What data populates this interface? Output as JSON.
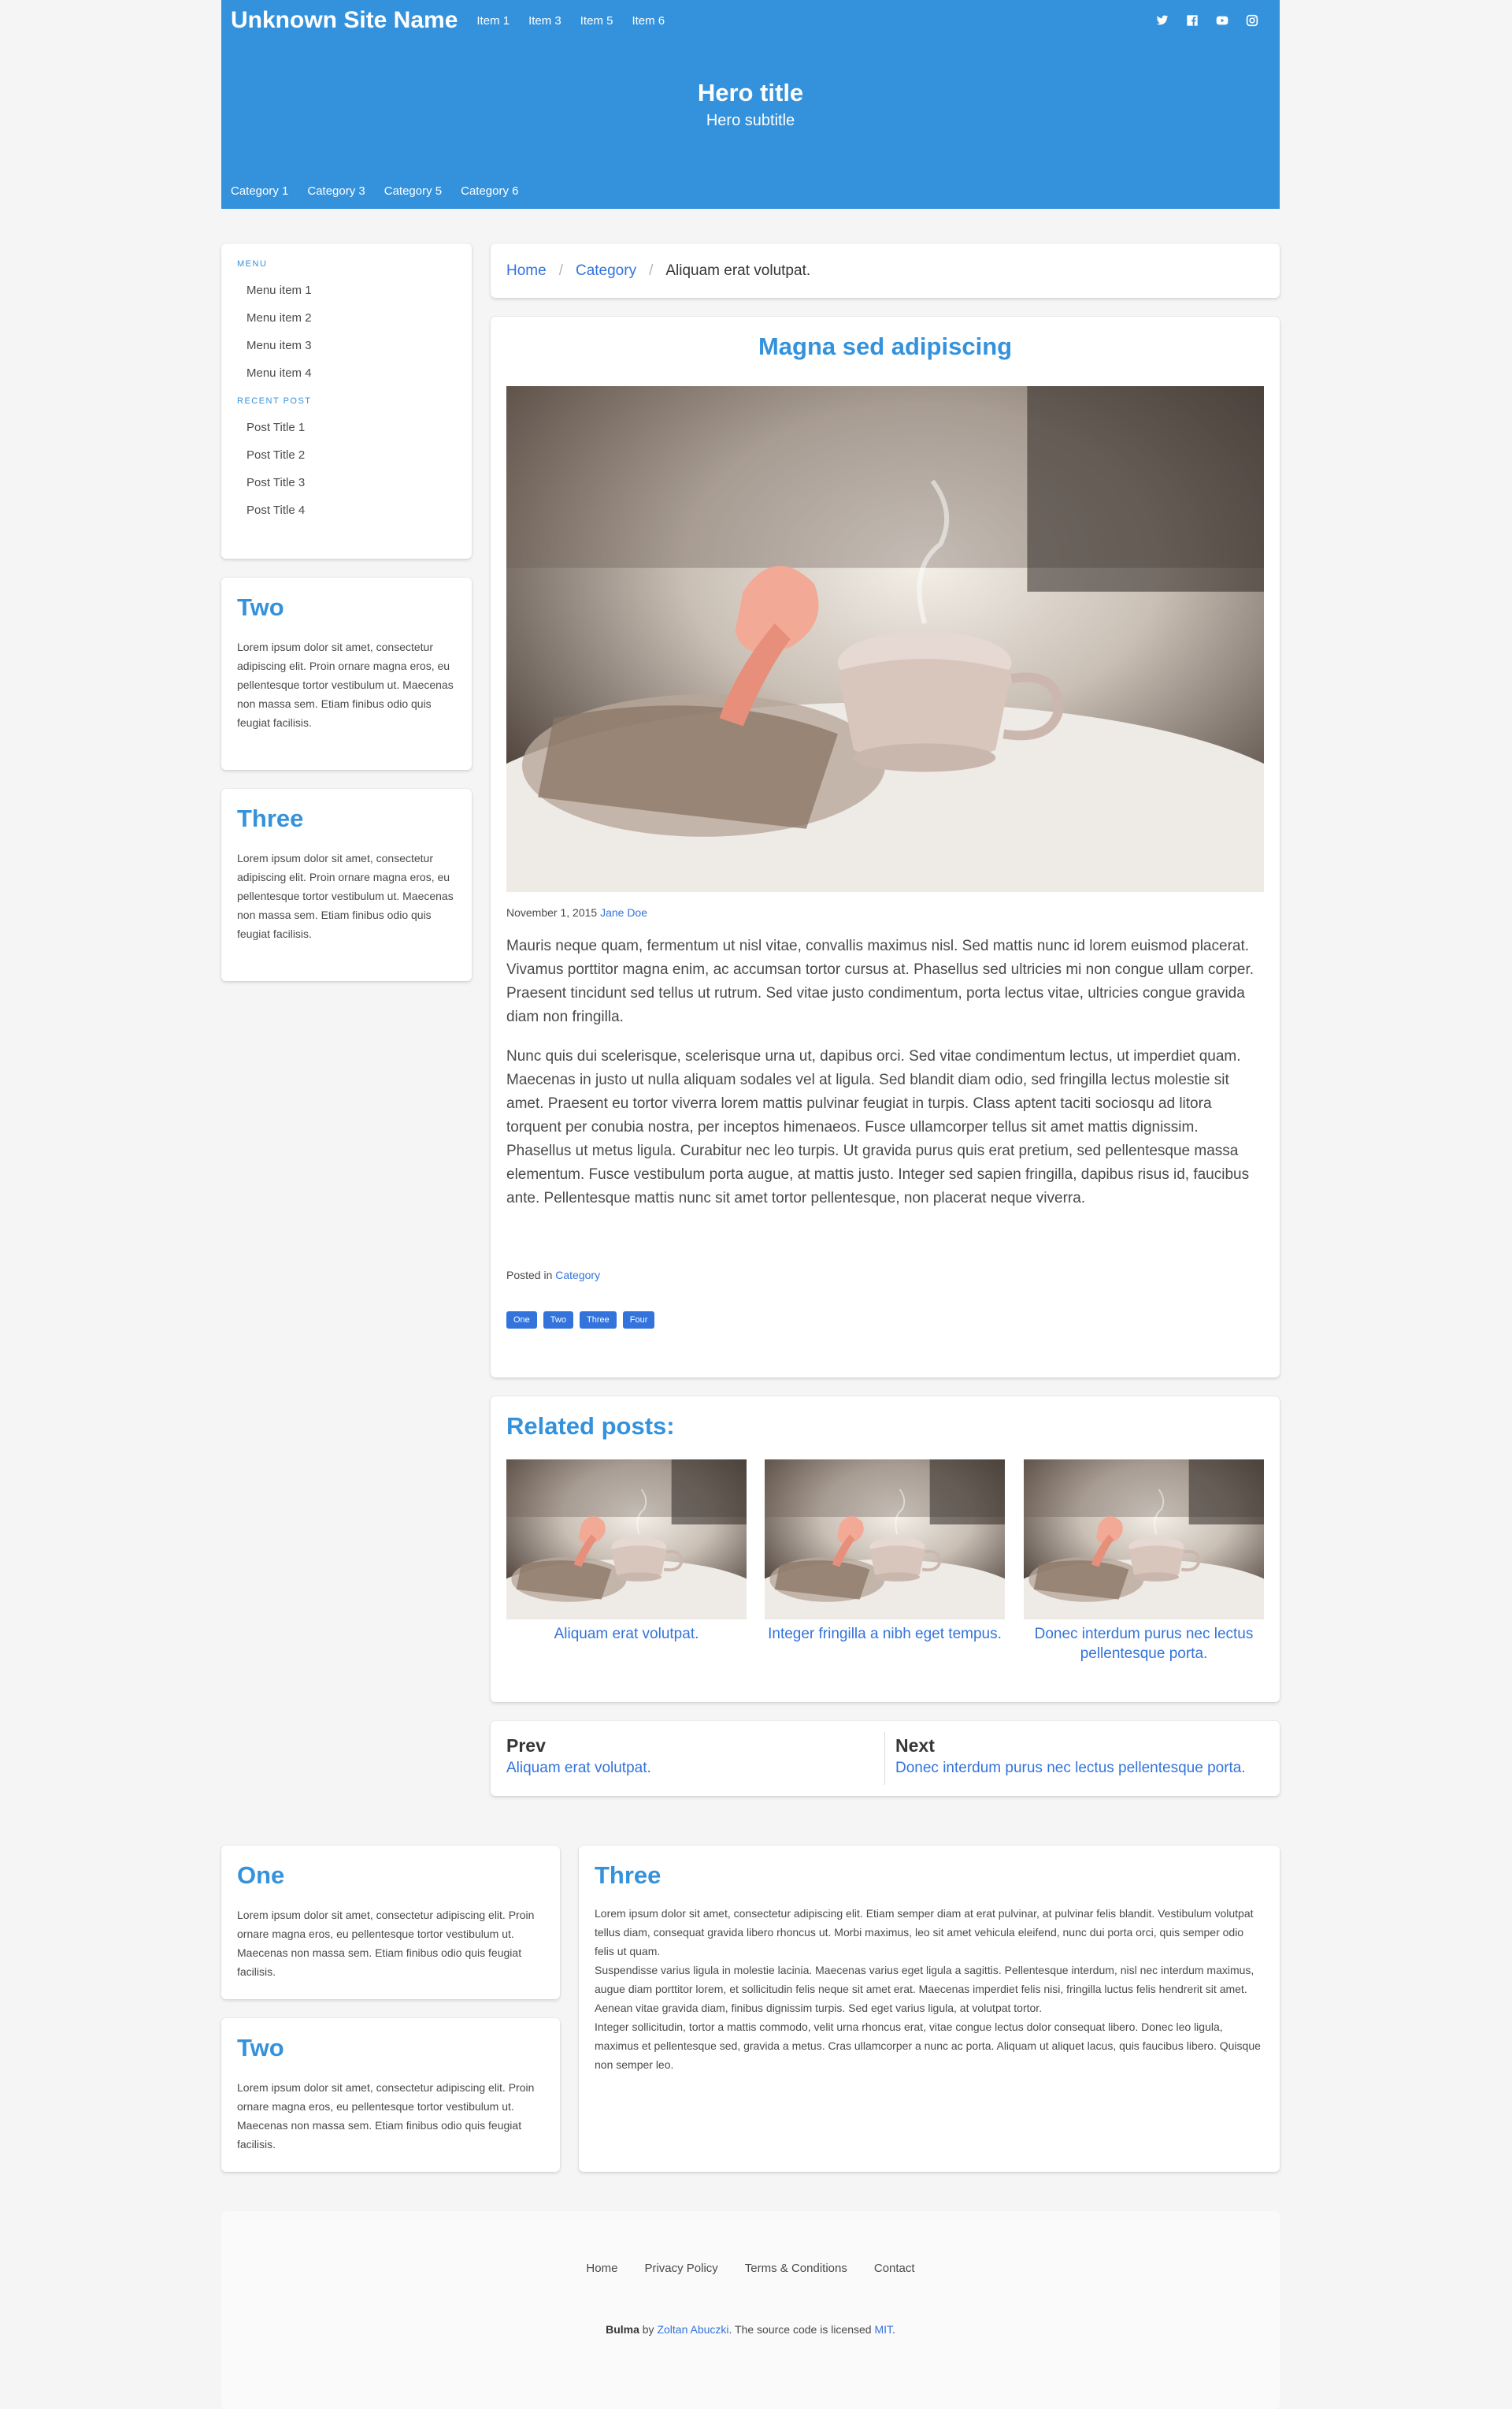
{
  "header": {
    "brand": "Unknown Site Name",
    "nav": [
      "Item 1",
      "Item 3",
      "Item 5",
      "Item 6"
    ],
    "social": [
      "twitter-icon",
      "facebook-icon",
      "youtube-icon",
      "instagram-icon"
    ],
    "hero_title": "Hero title",
    "hero_subtitle": "Hero subtitle",
    "categories": [
      "Category 1",
      "Category 3",
      "Category 5",
      "Category 6"
    ]
  },
  "sidebar": {
    "menu_label": "MENU",
    "menu_items": [
      "Menu item 1",
      "Menu item 2",
      "Menu item 3",
      "Menu item 4"
    ],
    "recent_label": "RECENT POST",
    "recent_items": [
      "Post Title 1",
      "Post Title 2",
      "Post Title 3",
      "Post Title 4"
    ],
    "cards": [
      {
        "title": "Two",
        "text": "Lorem ipsum dolor sit amet, consectetur adipiscing elit. Proin ornare magna eros, eu pellentesque tortor vestibulum ut. Maecenas non massa sem. Etiam finibus odio quis feugiat facilisis."
      },
      {
        "title": "Three",
        "text": "Lorem ipsum dolor sit amet, consectetur adipiscing elit. Proin ornare magna eros, eu pellentesque tortor vestibulum ut. Maecenas non massa sem. Etiam finibus odio quis feugiat facilisis."
      }
    ]
  },
  "breadcrumb": {
    "home": "Home",
    "category": "Category",
    "current": "Aliquam erat volutpat.",
    "separator": "/"
  },
  "post": {
    "title": "Magna sed adipiscing",
    "date": "November 1, 2015",
    "author": "Jane Doe",
    "paragraphs": [
      "Mauris neque quam, fermentum ut nisl vitae, convallis maximus nisl. Sed mattis nunc id lorem euismod placerat. Vivamus porttitor magna enim, ac accumsan tortor cursus at. Phasellus sed ultricies mi non congue ullam corper. Praesent tincidunt sed tellus ut rutrum. Sed vitae justo condimentum, porta lectus vitae, ultricies congue gravida diam non fringilla.",
      "Nunc quis dui scelerisque, scelerisque urna ut, dapibus orci. Sed vitae condimentum lectus, ut imperdiet quam. Maecenas in justo ut nulla aliquam sodales vel at ligula. Sed blandit diam odio, sed fringilla lectus molestie sit amet. Praesent eu tortor viverra lorem mattis pulvinar feugiat in turpis. Class aptent taciti sociosqu ad litora torquent per conubia nostra, per inceptos himenaeos. Fusce ullamcorper tellus sit amet mattis dignissim. Phasellus ut metus ligula. Curabitur nec leo turpis. Ut gravida purus quis erat pretium, sed pellentesque massa elementum. Fusce vestibulum porta augue, at mattis justo. Integer sed sapien fringilla, dapibus risus id, faucibus ante. Pellentesque mattis nunc sit amet tortor pellentesque, non placerat neque viverra."
    ],
    "posted_in_label": "Posted in",
    "posted_in_category": "Category",
    "tags": [
      "One",
      "Two",
      "Three",
      "Four"
    ]
  },
  "related": {
    "heading": "Related posts:",
    "items": [
      "Aliquam erat volutpat.",
      "Integer fringilla a nibh eget tempus.",
      "Donec interdum purus nec lectus pellentesque porta."
    ]
  },
  "pagination": {
    "prev_label": "Prev",
    "prev_link": "Aliquam erat volutpat.",
    "next_label": "Next",
    "next_link": "Donec interdum purus nec lectus pellentesque porta."
  },
  "bottom": {
    "one": {
      "title": "One",
      "text": "Lorem ipsum dolor sit amet, consectetur adipiscing elit. Proin ornare magna eros, eu pellentesque tortor vestibulum ut. Maecenas non massa sem. Etiam finibus odio quis feugiat facilisis."
    },
    "two": {
      "title": "Two",
      "text": "Lorem ipsum dolor sit amet, consectetur adipiscing elit. Proin ornare magna eros, eu pellentesque tortor vestibulum ut. Maecenas non massa sem. Etiam finibus odio quis feugiat facilisis."
    },
    "three": {
      "title": "Three",
      "paragraphs": [
        "Lorem ipsum dolor sit amet, consectetur adipiscing elit. Etiam semper diam at erat pulvinar, at pulvinar felis blandit. Vestibulum volutpat tellus diam, consequat gravida libero rhoncus ut. Morbi maximus, leo sit amet vehicula eleifend, nunc dui porta orci, quis semper odio felis ut quam.",
        "Suspendisse varius ligula in molestie lacinia. Maecenas varius eget ligula a sagittis. Pellentesque interdum, nisl nec interdum maximus, augue diam porttitor lorem, et sollicitudin felis neque sit amet erat. Maecenas imperdiet felis nisi, fringilla luctus felis hendrerit sit amet. Aenean vitae gravida diam, finibus dignissim turpis. Sed eget varius ligula, at volutpat tortor.",
        "Integer sollicitudin, tortor a mattis commodo, velit urna rhoncus erat, vitae congue lectus dolor consequat libero. Donec leo ligula, maximus et pellentesque sed, gravida a metus. Cras ullamcorper a nunc ac porta. Aliquam ut aliquet lacus, quis faucibus libero. Quisque non semper leo."
      ]
    }
  },
  "footer": {
    "links": [
      "Home",
      "Privacy Policy",
      "Terms & Conditions",
      "Contact"
    ],
    "credit_brand": "Bulma",
    "credit_by": " by ",
    "credit_author": "Zoltan Abuczki",
    "credit_mid": ". The source code is licensed ",
    "credit_license": "MIT",
    "credit_end": "."
  },
  "colors": {
    "primary": "#3492dc",
    "link": "#3273dc",
    "background": "#f5f5f5"
  }
}
